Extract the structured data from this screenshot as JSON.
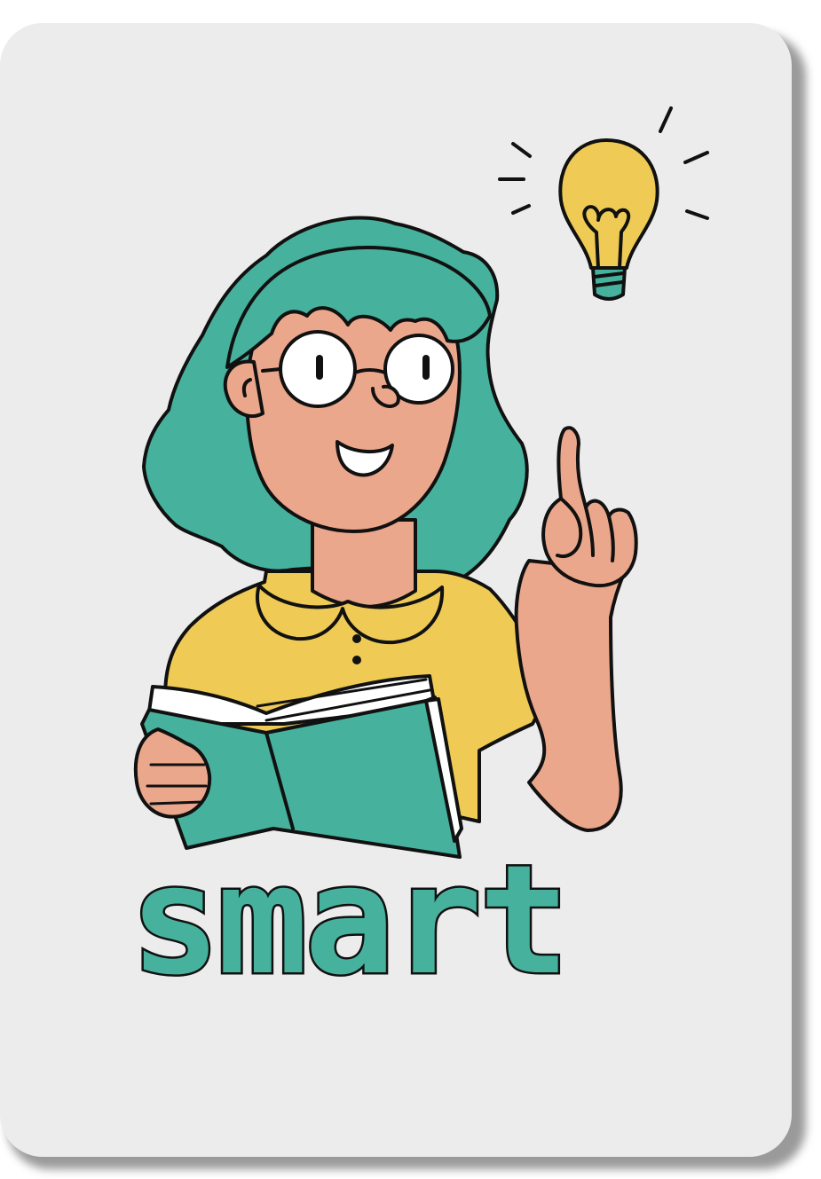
{
  "card": {
    "word": "smart",
    "illustration": "girl-with-book-and-lightbulb"
  },
  "colors": {
    "card_background": "#ececec",
    "hair": "#46b29d",
    "skin": "#eaa78b",
    "shirt": "#efcb55",
    "book": "#46b29d",
    "bulb": "#efcb55",
    "word_fill": "#46b29d",
    "outline": "#111111"
  },
  "icons": [
    "lightbulb-icon"
  ]
}
